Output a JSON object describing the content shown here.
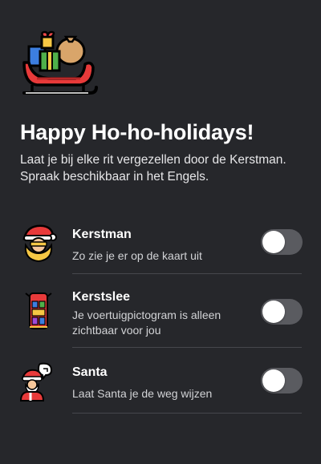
{
  "header": {
    "icon": "sleigh-with-gifts-icon",
    "title": "Happy Ho-ho-holidays!",
    "subtitle": "Laat je bij elke rit vergezellen door de Kerstman. Spraak beschikbaar in het Engels."
  },
  "options": [
    {
      "icon": "santa-face-icon",
      "name": "Kerstman",
      "description": "Zo zie je er op de kaart uit",
      "enabled": false
    },
    {
      "icon": "sleigh-vehicle-icon",
      "name": "Kerstslee",
      "description": "Je voertuigpictogram is alleen zichtbaar voor jou",
      "enabled": false
    },
    {
      "icon": "santa-speech-icon",
      "name": "Santa",
      "description": "Laat Santa je de weg wijzen",
      "enabled": false
    }
  ],
  "colors": {
    "background": "#26272b",
    "divider": "#46474c",
    "toggle_off": "#5a5b60",
    "sleigh_red": "#e83a3a",
    "gift_blue": "#3c7ee0",
    "gift_green": "#4fb04a"
  }
}
